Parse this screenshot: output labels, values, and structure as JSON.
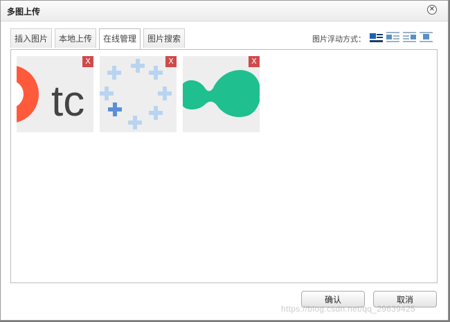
{
  "dialog": {
    "title": "多图上传",
    "close_icon": "close-icon"
  },
  "tabs": [
    {
      "label": "插入图片",
      "active": false
    },
    {
      "label": "本地上传",
      "active": false
    },
    {
      "label": "在线管理",
      "active": true
    },
    {
      "label": "图片搜索",
      "active": false
    }
  ],
  "float": {
    "label": "图片浮动方式：",
    "options": [
      "float-left-icon",
      "float-none-icon",
      "float-right-icon",
      "float-center-icon"
    ]
  },
  "images": [
    {
      "delete_label": "X",
      "icon": "tc-logo-image"
    },
    {
      "delete_label": "X",
      "icon": "loading-spinner-image"
    },
    {
      "delete_label": "X",
      "icon": "green-blob-image"
    }
  ],
  "buttons": {
    "confirm": "确认",
    "cancel": "取消"
  },
  "watermark": "https://blog.csdn.net/qq_29639425",
  "colors": {
    "delete_red": "#cf4a4a",
    "green": "#1fbf8f",
    "orange": "#ff5a3c"
  }
}
